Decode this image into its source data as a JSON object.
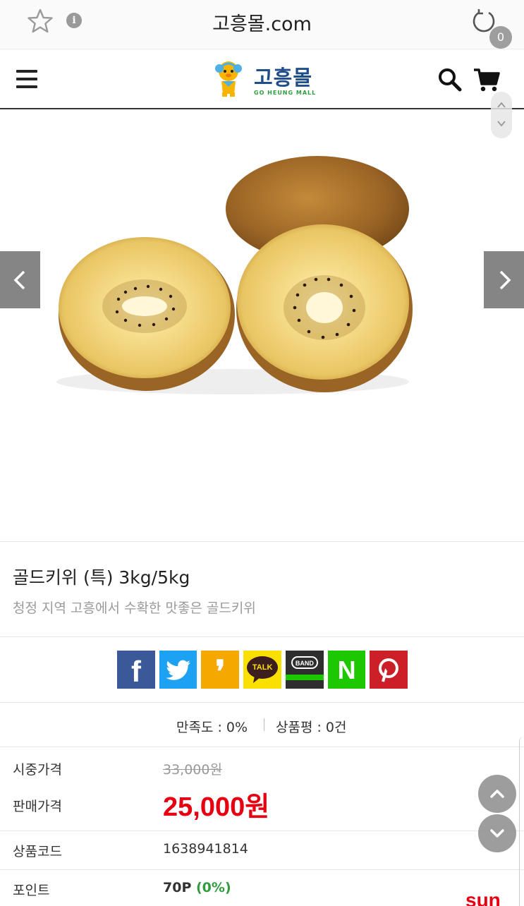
{
  "browser": {
    "url": "고흥몰.com",
    "icons": [
      "star-icon",
      "info-icon",
      "reload-icon"
    ]
  },
  "header": {
    "logo_text": "고흥몰",
    "logo_sub": "GO HEUNG MALL",
    "cart_count": "0",
    "icons": [
      "menu-icon",
      "search-icon",
      "cart-icon"
    ]
  },
  "product": {
    "name": "골드키위 (특) 3kg/5kg",
    "description": "청정 지역 고흥에서 수확한 맛좋은 골드키위"
  },
  "share": {
    "buttons": [
      {
        "name": "facebook",
        "glyph": "f",
        "color": "#3b5998"
      },
      {
        "name": "twitter",
        "glyph": "t",
        "color": "#1da1f2"
      },
      {
        "name": "kakaostory",
        "glyph": "❜",
        "color": "#f5a800"
      },
      {
        "name": "kakaotalk",
        "glyph": "TALK",
        "color": "#f9e000"
      },
      {
        "name": "band",
        "glyph": "BAND",
        "color": "#2e2e2e"
      },
      {
        "name": "naver",
        "glyph": "N",
        "color": "#1ec800"
      },
      {
        "name": "pinterest",
        "glyph": "p",
        "color": "#cb2027"
      }
    ]
  },
  "stats": {
    "satisfaction": "만족도 : 0%",
    "reviews": "상품평 : 0건"
  },
  "info": {
    "market_price_label": "시중가격",
    "market_price": "33,000원",
    "sale_price_label": "판매가격",
    "sale_price": "25,000원",
    "code_label": "상품코드",
    "code": "1638941814",
    "point_label": "포인트",
    "point": "70P",
    "point_pct": "(0%)"
  },
  "partner_logo": "sun",
  "colors": {
    "accent_red": "#e60012",
    "brand_blue": "#1f4e8a",
    "brand_green": "#2f9c40"
  }
}
